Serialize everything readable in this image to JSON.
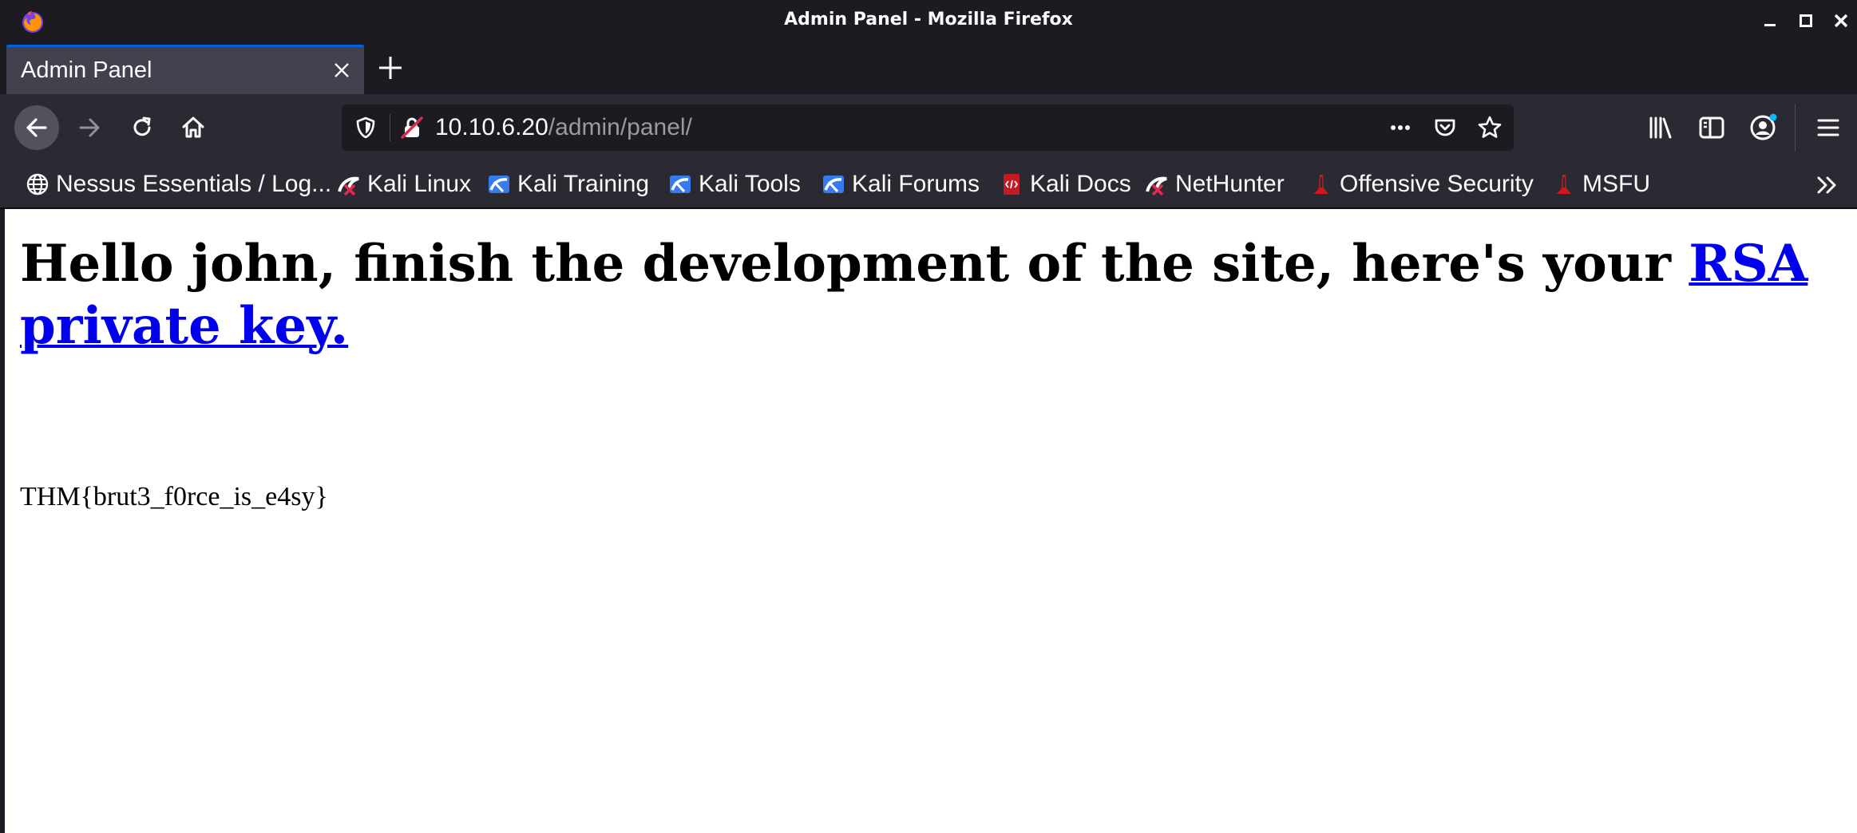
{
  "window": {
    "title": "Admin Panel - Mozilla Firefox"
  },
  "tab": {
    "label": "Admin Panel"
  },
  "address_bar": {
    "host": "10.10.6.20",
    "path": "/admin/panel/"
  },
  "bookmarks": [
    {
      "label": "Nessus Essentials / Log...",
      "icon": "globe-icon"
    },
    {
      "label": "Kali Linux",
      "icon": "kali-icon"
    },
    {
      "label": "Kali Training",
      "icon": "kali-training-icon"
    },
    {
      "label": "Kali Tools",
      "icon": "kali-tools-icon"
    },
    {
      "label": "Kali Forums",
      "icon": "kali-forums-icon"
    },
    {
      "label": "Kali Docs",
      "icon": "kali-docs-icon"
    },
    {
      "label": "NetHunter",
      "icon": "nethunter-icon"
    },
    {
      "label": "Offensive Security",
      "icon": "offsec-icon"
    },
    {
      "label": "MSFU",
      "icon": "msfu-icon"
    }
  ],
  "page": {
    "heading": "Hello john, finish the development of the site, here's your ",
    "link_text": "RSA private key.",
    "flag": "THM{brut3_f0rce_is_e4sy}"
  },
  "colors": {
    "titlebar": "#1c1b22",
    "toolbar": "#2b2a33",
    "tab_active": "#42414d",
    "accent": "#0061e0",
    "link": "#0000ee"
  }
}
